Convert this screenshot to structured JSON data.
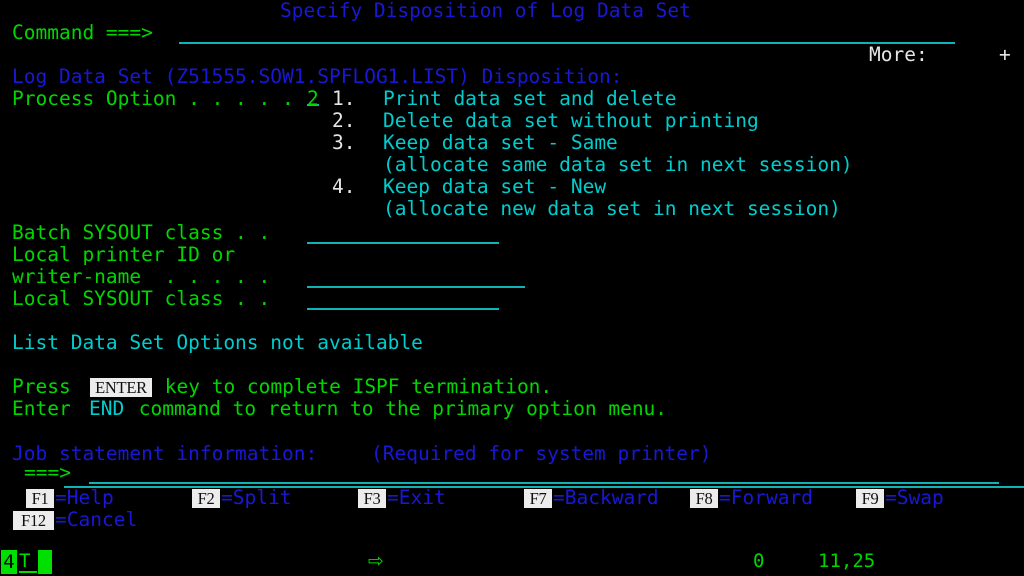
{
  "screen": {
    "title": "Specify Disposition of Log Data Set",
    "rows": 24,
    "cols": 80,
    "colors": {
      "green": "#00d700",
      "cyan": "#00cdcd",
      "blue": "#1818d6",
      "white": "#e6e6e6",
      "background": "#000000",
      "field_underline": "#0fb3b3"
    }
  },
  "command_line": {
    "label": "Command ===>",
    "value": "",
    "placeholder": ""
  },
  "more_indicator": {
    "label": "More:",
    "value": "+"
  },
  "header": {
    "dataset_line": "Log Data Set (Z51555.SOW1.SPFLOG1.LIST) Disposition:"
  },
  "process_option": {
    "label": "Process Option . . . . .",
    "value": "2"
  },
  "options": [
    {
      "num": "1.",
      "text": "Print data set and delete"
    },
    {
      "num": "2.",
      "text": "Delete data set without printing"
    },
    {
      "num": "3.",
      "text": "Keep data set - Same"
    },
    {
      "num": "",
      "text": "(allocate same data set in next session)"
    },
    {
      "num": "4.",
      "text": "Keep data set - New"
    },
    {
      "num": "",
      "text": "(allocate new data set in next session)"
    }
  ],
  "fields": [
    {
      "label": "Batch SYSOUT class . .",
      "value": ""
    },
    {
      "label": "Local printer ID or",
      "value": null
    },
    {
      "label": "writer-name  . . . . .",
      "value": ""
    },
    {
      "label": "Local SYSOUT class . .",
      "value": ""
    }
  ],
  "notice": "List Data Set Options not available",
  "instructions": {
    "line1_pre": "Press ",
    "line1_key": "ENTER",
    "line1_post": " key to complete ISPF termination.",
    "line2_pre": "Enter ",
    "line2_key": "END",
    "line2_post": " command to return to the primary option menu."
  },
  "job_statement": {
    "label": "Job statement information:",
    "hint": "(Required for system printer)",
    "prompt": "===>",
    "value": ""
  },
  "function_keys": [
    {
      "key": "F1",
      "label": "=Help"
    },
    {
      "key": "F2",
      "label": "=Split"
    },
    {
      "key": "F3",
      "label": "=Exit"
    },
    {
      "key": "F7",
      "label": "=Backward"
    },
    {
      "key": "F8",
      "label": "=Forward"
    },
    {
      "key": "F9",
      "label": "=Swap"
    },
    {
      "key": "F12",
      "label": "=Cancel"
    }
  ],
  "status_bar": {
    "session_number": "4",
    "connection_indicator": "T",
    "insert_arrow": "⇨",
    "field_count": "0",
    "cursor_position": "11,25"
  }
}
